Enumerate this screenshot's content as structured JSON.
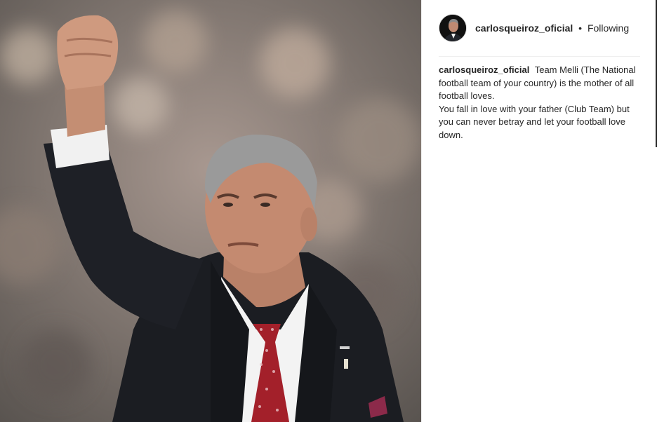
{
  "post": {
    "username": "carlosqueiroz_oficial",
    "separator": "•",
    "follow_status": "Following",
    "caption": {
      "author": "carlosqueiroz_oficial",
      "line1": "Team Melli (The National football team of your country) is the mother of all football loves.",
      "line2": "You fall in love with your father (Club Team) but you can never betray and let your football love down."
    }
  },
  "colors": {
    "text": "#262626",
    "divider": "#efefef",
    "suit": "#1b1d22",
    "tie": "#a3202a"
  }
}
